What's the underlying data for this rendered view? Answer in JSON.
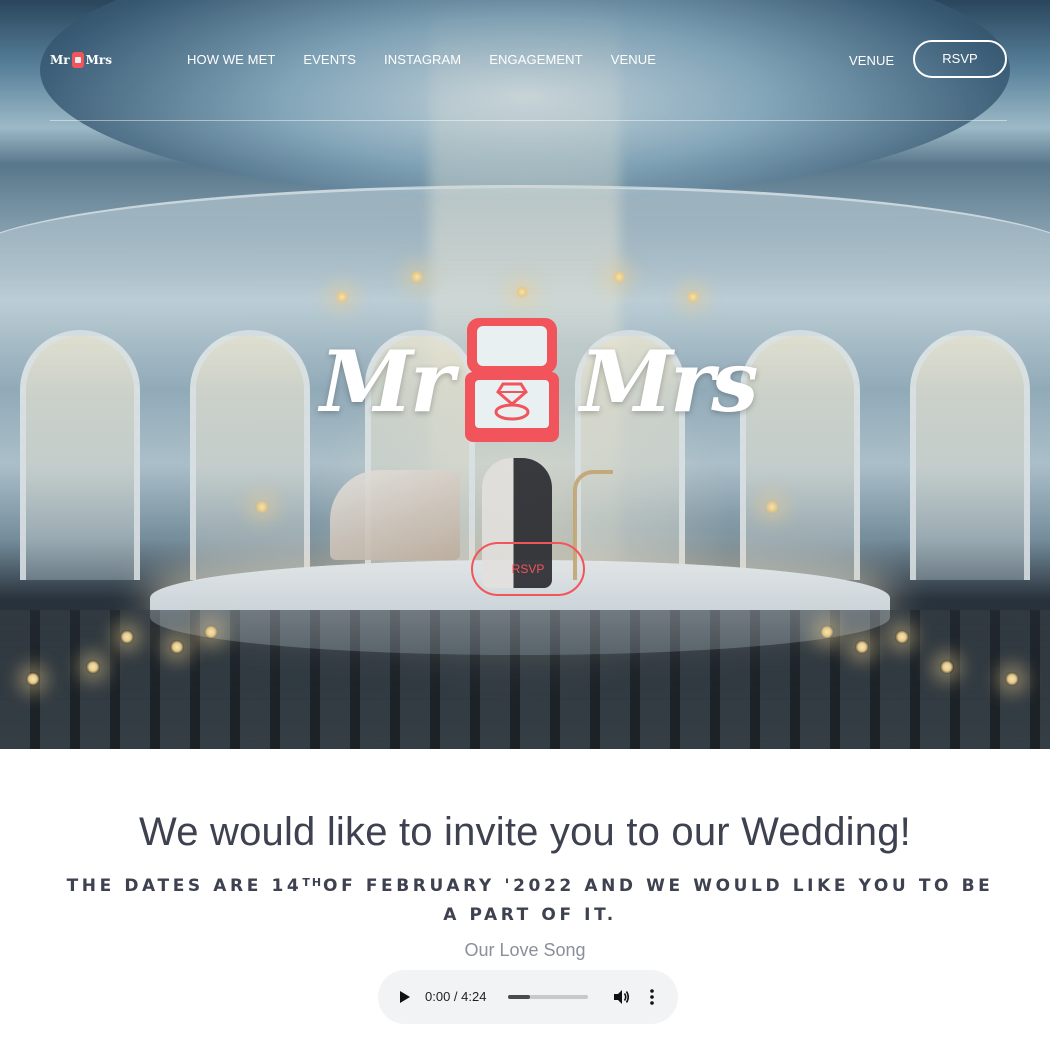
{
  "header": {
    "logo": {
      "left_word": "Mr",
      "right_word": "Mrs"
    },
    "nav_items": [
      {
        "label": "HOW WE MET"
      },
      {
        "label": "EVENTS"
      },
      {
        "label": "INSTAGRAM"
      },
      {
        "label": "ENGAGEMENT"
      },
      {
        "label": "VENUE"
      }
    ],
    "right_link": "VENUE",
    "rsvp_button": "RSVP"
  },
  "hero": {
    "logo": {
      "left_word": "Mr",
      "right_word": "Mrs",
      "icon": "ring-box-icon"
    },
    "rsvp_button": "RSVP"
  },
  "invitation": {
    "title": "We would like to invite you to our Wedding!",
    "dates_prefix": "THE DATES ARE 14",
    "dates_sup": "TH",
    "dates_suffix": "OF FEBRUARY '2022 AND WE WOULD LIKE YOU TO BE A PART OF IT.",
    "song_label": "Our Love Song"
  },
  "audio_player": {
    "time": "0:00 / 4:24",
    "progress": 0.28,
    "icons": [
      "play-icon",
      "volume-icon",
      "more-options-icon"
    ]
  },
  "colors": {
    "accent": "#f2545b",
    "text": "#3d4150",
    "muted": "#8a8f9b",
    "player_bg": "#f1f3f4"
  }
}
